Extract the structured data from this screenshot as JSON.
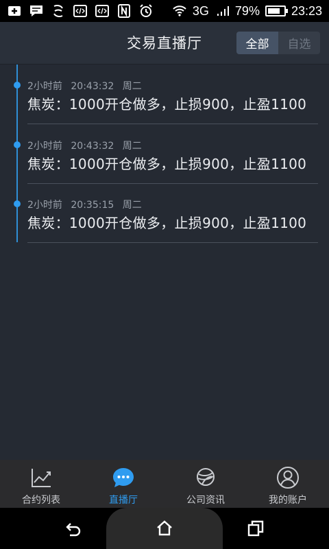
{
  "status_bar": {
    "battery_text": "79%",
    "battery_level": 0.79,
    "time": "23:23",
    "network": "3G",
    "icons": [
      "add-icon",
      "message-icon",
      "sync-icon",
      "code-icon",
      "code-icon",
      "nfc-icon",
      "alarm-icon",
      "wifi-icon",
      "signal-icon",
      "battery-icon"
    ]
  },
  "header": {
    "title": "交易直播厅",
    "segments": {
      "all": "全部",
      "favorites": "自选"
    }
  },
  "feed": {
    "items": [
      {
        "ago": "2小时前",
        "time": "20:43:32",
        "weekday": "周二",
        "message": "焦炭：1000开仓做多，止损900，止盈1100"
      },
      {
        "ago": "2小时前",
        "time": "20:43:32",
        "weekday": "周二",
        "message": "焦炭：1000开仓做多，止损900，止盈1100"
      },
      {
        "ago": "2小时前",
        "time": "20:35:15",
        "weekday": "周二",
        "message": "焦炭：1000开仓做多，止损900，止盈1100"
      }
    ]
  },
  "tabs": [
    {
      "label": "合约列表",
      "icon": "chart-icon"
    },
    {
      "label": "直播厅",
      "icon": "chat-bubble-icon"
    },
    {
      "label": "公司资讯",
      "icon": "globe-icon"
    },
    {
      "label": "我的账户",
      "icon": "user-icon"
    }
  ],
  "colors": {
    "accent": "#2f9cf0",
    "background": "#252a33",
    "header": "#2a303a",
    "tabbar": "#2b2b2d"
  }
}
